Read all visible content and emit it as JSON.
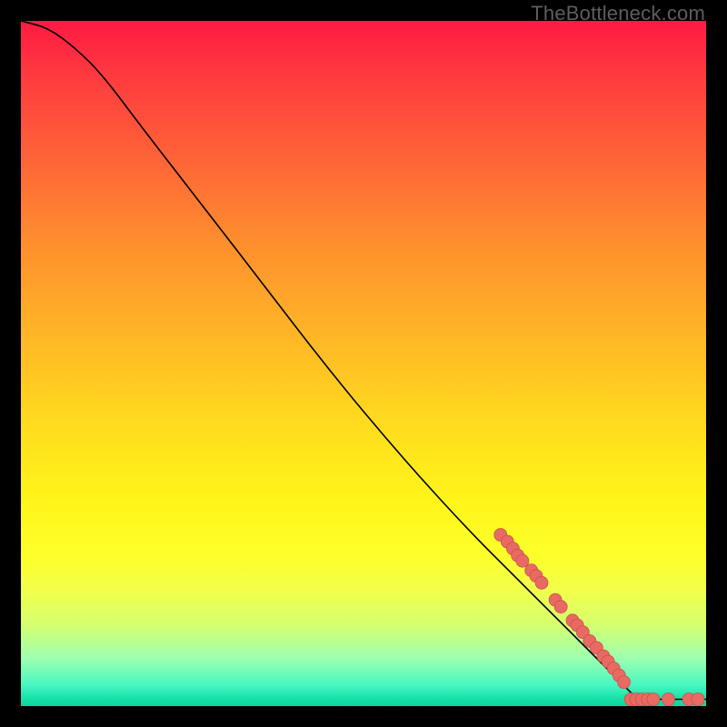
{
  "watermark": "TheBottleneck.com",
  "colors": {
    "background": "#000000",
    "curve_stroke": "#000000",
    "marker_fill": "#e86a63",
    "marker_stroke": "#c9524c"
  },
  "chart_data": {
    "type": "line",
    "title": "",
    "xlabel": "",
    "ylabel": "",
    "xlim": [
      0,
      100
    ],
    "ylim": [
      0,
      100
    ],
    "curve": [
      {
        "x": 0,
        "y": 100
      },
      {
        "x": 4,
        "y": 99
      },
      {
        "x": 8,
        "y": 96
      },
      {
        "x": 12,
        "y": 92
      },
      {
        "x": 18,
        "y": 84
      },
      {
        "x": 25,
        "y": 75
      },
      {
        "x": 35,
        "y": 62
      },
      {
        "x": 45,
        "y": 49
      },
      {
        "x": 55,
        "y": 37
      },
      {
        "x": 65,
        "y": 26
      },
      {
        "x": 72,
        "y": 19
      },
      {
        "x": 78,
        "y": 13
      },
      {
        "x": 83,
        "y": 8
      },
      {
        "x": 87,
        "y": 4
      },
      {
        "x": 89,
        "y": 2
      },
      {
        "x": 90,
        "y": 1
      },
      {
        "x": 92,
        "y": 1
      },
      {
        "x": 95,
        "y": 1
      },
      {
        "x": 98,
        "y": 1
      },
      {
        "x": 100,
        "y": 1
      }
    ],
    "markers": [
      {
        "x": 70.0,
        "y": 25.0
      },
      {
        "x": 71.0,
        "y": 24.0
      },
      {
        "x": 71.8,
        "y": 23.0
      },
      {
        "x": 72.5,
        "y": 22.0
      },
      {
        "x": 73.2,
        "y": 21.2
      },
      {
        "x": 74.5,
        "y": 19.8
      },
      {
        "x": 75.2,
        "y": 19.0
      },
      {
        "x": 76.0,
        "y": 18.0
      },
      {
        "x": 78.0,
        "y": 15.5
      },
      {
        "x": 78.8,
        "y": 14.5
      },
      {
        "x": 80.5,
        "y": 12.5
      },
      {
        "x": 81.2,
        "y": 11.8
      },
      {
        "x": 82.0,
        "y": 10.8
      },
      {
        "x": 83.0,
        "y": 9.5
      },
      {
        "x": 84.0,
        "y": 8.5
      },
      {
        "x": 85.0,
        "y": 7.3
      },
      {
        "x": 85.7,
        "y": 6.5
      },
      {
        "x": 86.5,
        "y": 5.5
      },
      {
        "x": 87.3,
        "y": 4.5
      },
      {
        "x": 88.0,
        "y": 3.5
      },
      {
        "x": 89.0,
        "y": 1.0
      },
      {
        "x": 89.8,
        "y": 1.0
      },
      {
        "x": 90.6,
        "y": 1.0
      },
      {
        "x": 91.5,
        "y": 1.0
      },
      {
        "x": 92.3,
        "y": 1.0
      },
      {
        "x": 94.5,
        "y": 1.0
      },
      {
        "x": 97.5,
        "y": 1.0
      },
      {
        "x": 98.8,
        "y": 1.0
      }
    ]
  }
}
